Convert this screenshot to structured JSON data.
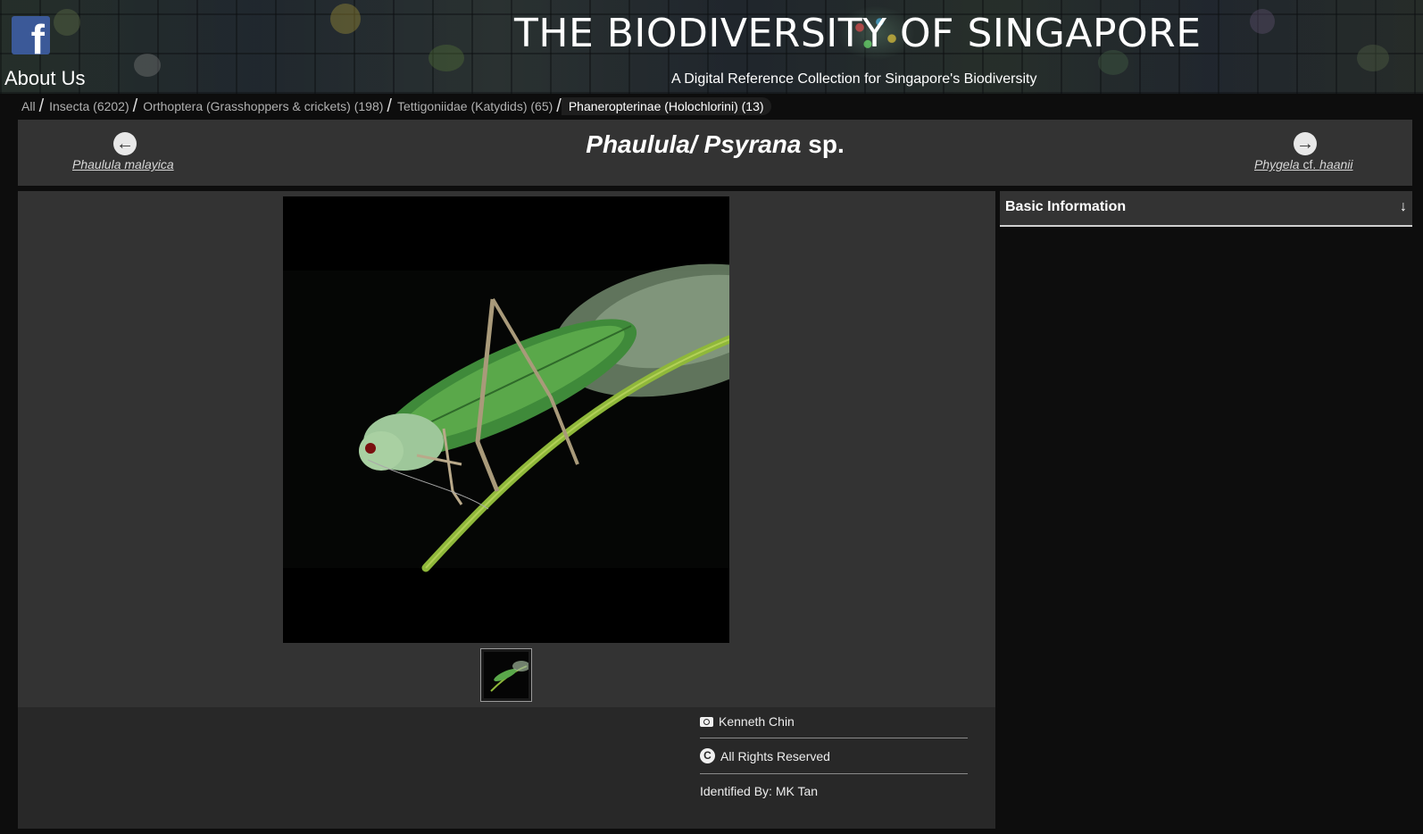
{
  "header": {
    "facebook_glyph": "f",
    "about_label": "About Us",
    "site_title": "THE BIODIVERSITY OF SINGAPORE",
    "site_subtitle": "A Digital Reference Collection for Singapore's Biodiversity"
  },
  "breadcrumb": {
    "items": [
      {
        "label": "All"
      },
      {
        "label": "Insecta (6202)"
      },
      {
        "label": "Orthoptera (Grasshoppers & crickets) (198)"
      },
      {
        "label": "Tettigoniidae (Katydids) (65)"
      },
      {
        "label": "Phaneropterinae (Holochlorini) (13)"
      }
    ]
  },
  "species_nav": {
    "title_italic": "Phaulula/ Psyrana",
    "title_suffix": " sp.",
    "prev": {
      "name": "Phaulula malayica",
      "icon": "arrow-left-circle-icon"
    },
    "next": {
      "name_italic_part1": "Phygela",
      "name_plain": " cf. ",
      "name_italic_part2": "haanii",
      "icon": "arrow-right-circle-icon"
    }
  },
  "credits": {
    "photographer": "Kenneth Chin",
    "license": "All Rights Reserved",
    "identified_by": "Identified By: MK Tan"
  },
  "info_panel": {
    "title": "Basic Information",
    "toggle_glyph": "↓"
  },
  "colors": {
    "panel_bg": "#333333",
    "page_bg": "#0d0d0d",
    "facebook_blue": "#3b5998",
    "katydid_green": "#6aa84f"
  }
}
